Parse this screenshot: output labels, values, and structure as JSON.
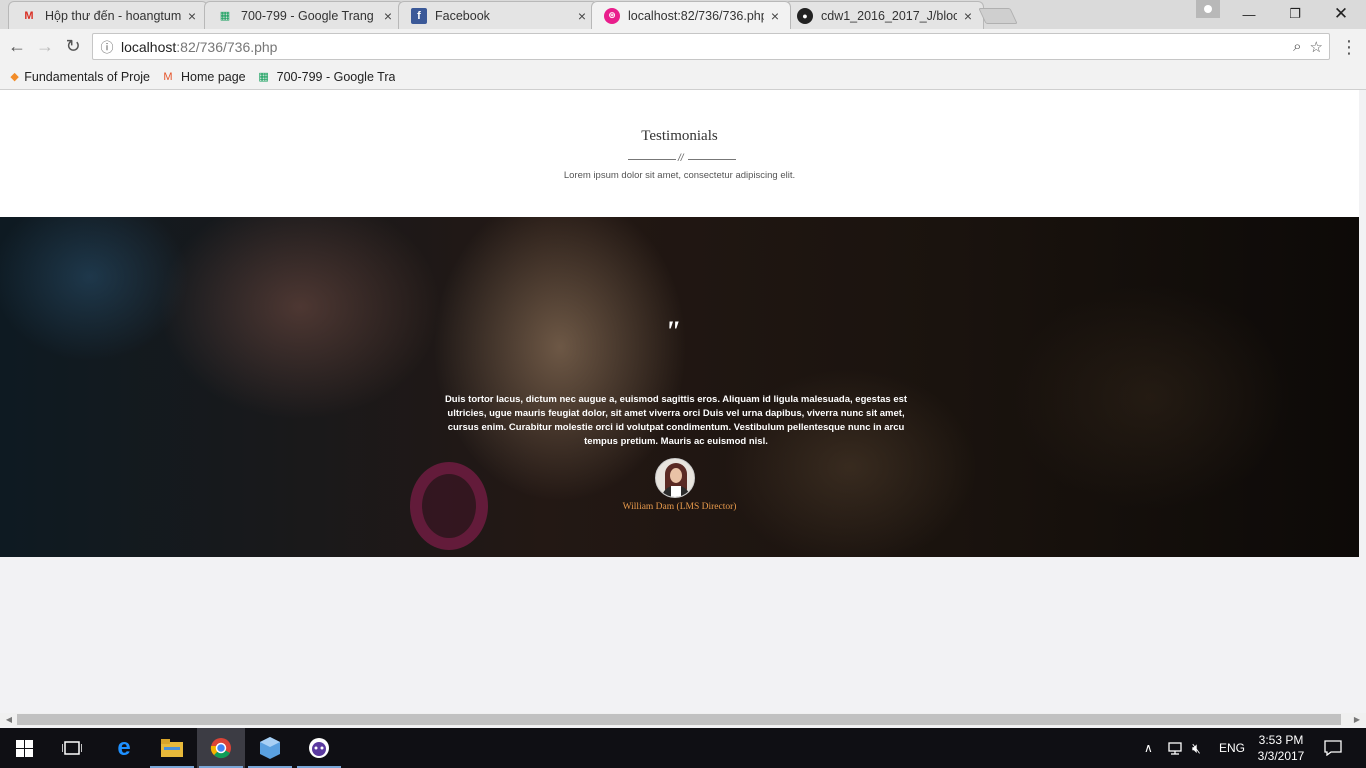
{
  "browser": {
    "tabs": [
      {
        "title": "Hộp thư đến - hoangtum",
        "favicon": "gmail-icon",
        "color": "#d93025"
      },
      {
        "title": "700-799 - Google Trang t",
        "favicon": "sheets-icon",
        "color": "#0f9d58"
      },
      {
        "title": "Facebook",
        "favicon": "facebook-icon",
        "color": "#3b5998"
      },
      {
        "title": "localhost:82/736/736.php",
        "favicon": "site-icon",
        "color": "#e91e8c"
      },
      {
        "title": "cdw1_2016_2017_J/block",
        "favicon": "github-icon",
        "color": "#222222"
      }
    ],
    "address": {
      "host": "localhost",
      "path": ":82/736/736.php"
    },
    "bookmarks": [
      {
        "label": "Fundamentals of Proje",
        "icon": "course-icon"
      },
      {
        "label": "Home page",
        "icon": "magento-icon"
      },
      {
        "label": "700-799 - Google Tra",
        "icon": "sheets-icon"
      }
    ]
  },
  "page": {
    "section_title": "Testimonials",
    "section_subtitle": "Lorem ipsum dolor sit amet, consectetur adipiscing elit.",
    "quote_mark": "\"",
    "quote": "Duis tortor lacus, dictum nec augue a, euismod sagittis eros. Aliquam id ligula malesuada, egestas est ultricies, ugue mauris feugiat dolor, sit amet viverra orci Duis vel urna dapibus, viverra nunc sit amet, cursus enim. Curabitur molestie orci id volutpat condimentum. Vestibulum pellentesque nunc in arcu tempus pretium. Mauris ac euismod nisl.",
    "author": "William Dam (LMS Director)",
    "author_color": "#e89a4c"
  },
  "taskbar": {
    "language": "ENG",
    "time": "3:53 PM",
    "date": "3/3/2017"
  }
}
